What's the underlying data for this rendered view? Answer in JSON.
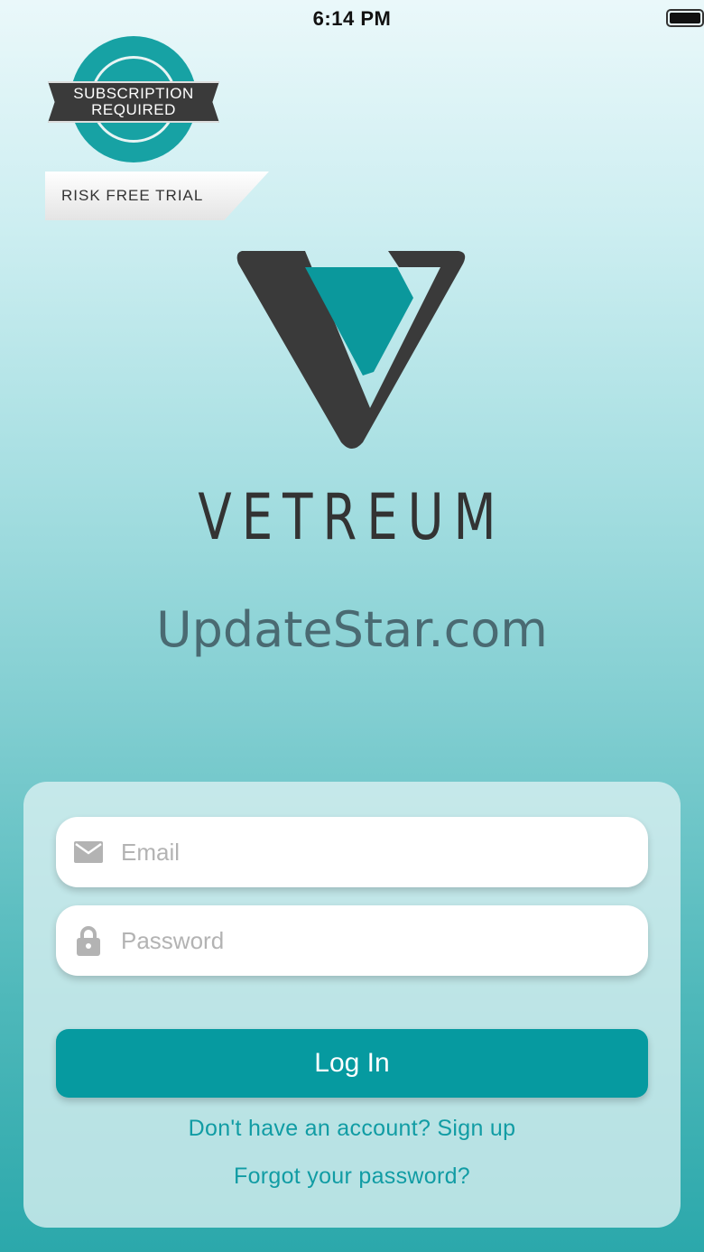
{
  "status_bar": {
    "time": "6:14 PM"
  },
  "badge": {
    "line1": "SUBSCRIPTION",
    "line2": "REQUIRED",
    "trial": "RISK FREE TRIAL"
  },
  "brand": {
    "name": "VETREUM",
    "logo_icon": "vetreum-v-logo"
  },
  "watermark": "UpdateStar.com",
  "login": {
    "email_placeholder": "Email",
    "email_value": "",
    "password_placeholder": "Password",
    "password_value": "",
    "login_label": "Log In",
    "signup_text": "Don't have an account? Sign up",
    "forgot_text": "Forgot your password?"
  },
  "colors": {
    "accent": "#069aa0",
    "logo_dark": "#3a3a3a",
    "logo_teal": "#0b989c",
    "link": "#119ca4"
  }
}
